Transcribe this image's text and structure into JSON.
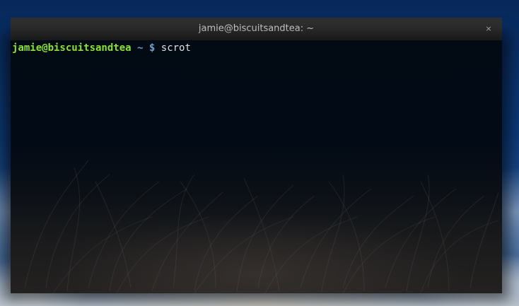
{
  "window": {
    "title": "jamie@biscuitsandtea: ~",
    "close_glyph": "×"
  },
  "terminal": {
    "prompt_user_host": "jamie@biscuitsandtea",
    "prompt_dir": "~",
    "prompt_symbol": "$",
    "command": "scrot"
  },
  "colors": {
    "prompt_user": "#8ae234",
    "prompt_path": "#729fcf",
    "text": "#e0e0e0",
    "titlebar": "#2f2f2f"
  },
  "icons": {
    "close": "close-icon"
  }
}
